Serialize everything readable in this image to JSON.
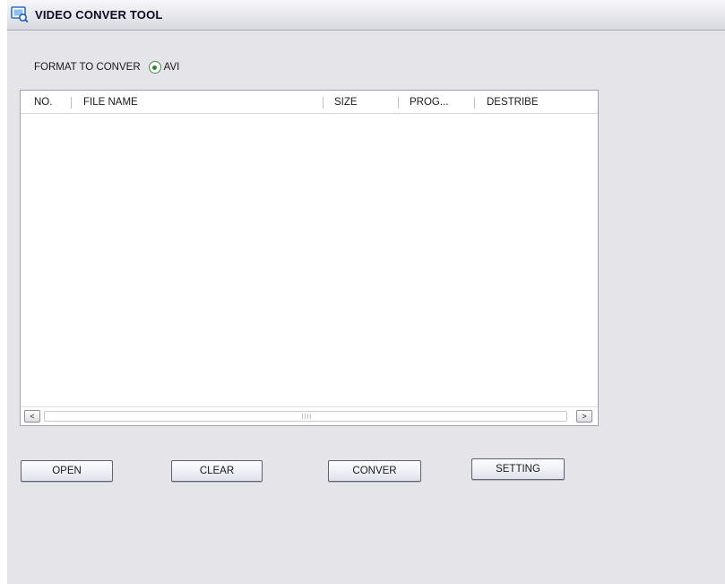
{
  "window": {
    "title": "VIDEO CONVER TOOL",
    "icon": "app-video-icon"
  },
  "format": {
    "label": "FORMAT TO CONVER",
    "options": [
      {
        "label": "AVI",
        "selected": true
      }
    ]
  },
  "table": {
    "columns": [
      "NO.",
      "FILE NAME",
      "SIZE",
      "PROG...",
      "DESTRIBE"
    ],
    "rows": []
  },
  "scrollbar": {
    "left_glyph": "<",
    "right_glyph": ">"
  },
  "buttons": {
    "open": "OPEN",
    "clear": "CLEAR",
    "conver": "CONVER",
    "setting": "SETTING"
  },
  "colors": {
    "window_bg": "#e5e4e9",
    "radio_selected": "#2f8a2f"
  }
}
